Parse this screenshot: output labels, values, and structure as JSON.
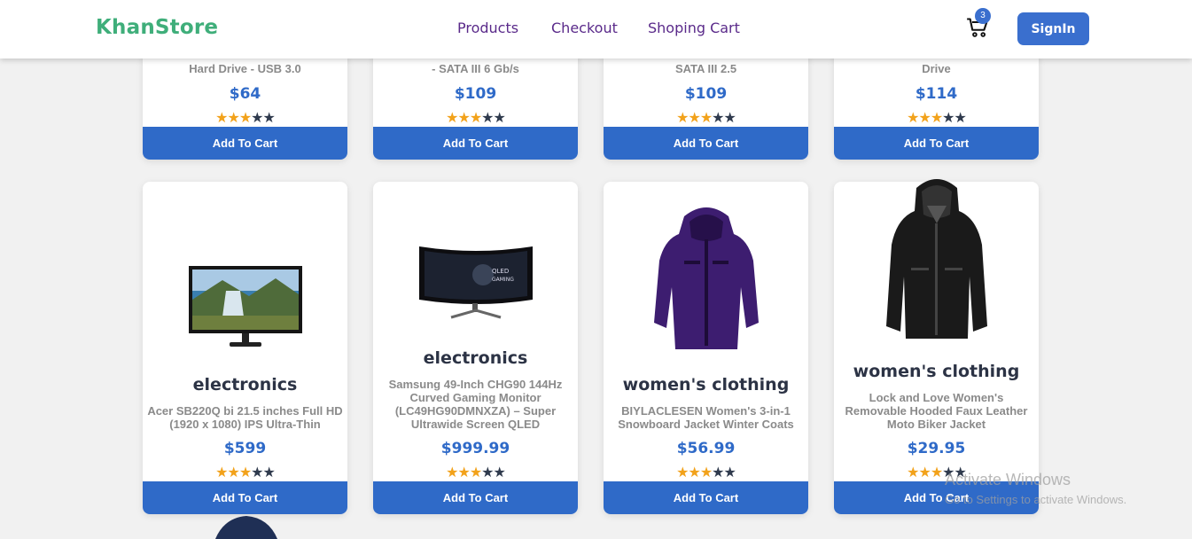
{
  "header": {
    "brand": "KhanStore",
    "nav": [
      "Products",
      "Checkout",
      "Shoping Cart"
    ],
    "cart_count": "3",
    "signin_label": "SignIn"
  },
  "products_top": [
    {
      "title_tail": "Hard Drive - USB 3.0",
      "price": "$64",
      "rating": 3,
      "button": "Add To Cart"
    },
    {
      "title_tail": "- SATA III 6 Gb/s",
      "price": "$109",
      "rating": 3,
      "button": "Add To Cart"
    },
    {
      "title_tail": "SATA III 2.5",
      "price": "$109",
      "rating": 3,
      "button": "Add To Cart"
    },
    {
      "title_tail": "Drive",
      "price": "$114",
      "rating": 3,
      "button": "Add To Cart"
    }
  ],
  "products": [
    {
      "category": "electronics",
      "title": "Acer SB220Q bi 21.5 inches Full HD (1920 x 1080) IPS Ultra-Thin",
      "price": "$599",
      "rating": 3,
      "button": "Add To Cart",
      "image": "monitor"
    },
    {
      "category": "electronics",
      "title": "Samsung 49-Inch CHG90 144Hz Curved Gaming Monitor (LC49HG90DMNXZA) – Super Ultrawide Screen QLED",
      "price": "$999.99",
      "rating": 3,
      "button": "Add To Cart",
      "image": "curved-monitor"
    },
    {
      "category": "women's clothing",
      "title": "BIYLACLESEN Women's 3-in-1 Snowboard Jacket Winter Coats",
      "price": "$56.99",
      "rating": 3,
      "button": "Add To Cart",
      "image": "purple-jacket"
    },
    {
      "category": "women's clothing",
      "title": "Lock and Love Women's Removable Hooded Faux Leather Moto Biker Jacket",
      "price": "$29.95",
      "rating": 3,
      "button": "Add To Cart",
      "image": "leather-jacket"
    }
  ],
  "watermark": {
    "line1": "Activate Windows",
    "line2": "Go to Settings to activate Windows."
  },
  "colors": {
    "brand": "#3fae7a",
    "nav": "#5a2a8a",
    "accent": "#2f6ac8",
    "star_on": "#f2a21b",
    "star_off": "#2f3a4d"
  }
}
